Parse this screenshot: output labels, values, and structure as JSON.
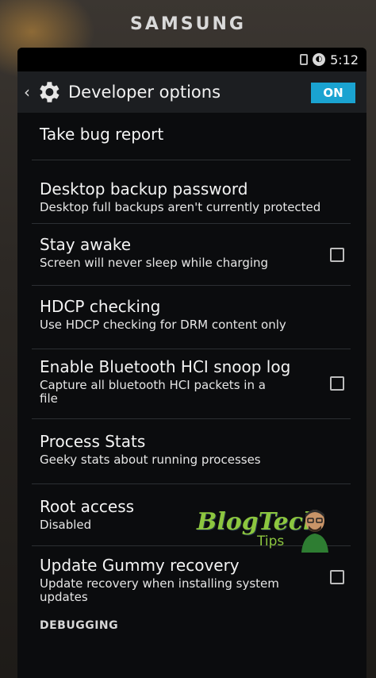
{
  "device": {
    "brand": "SAMSUNG"
  },
  "statusbar": {
    "time": "5:12"
  },
  "actionbar": {
    "title": "Developer options",
    "toggle_label": "ON",
    "accent": "#1aa3d1"
  },
  "items": [
    {
      "title": "Take bug report",
      "summary": ""
    },
    {
      "title": "Desktop backup password",
      "summary": "Desktop full backups aren't currently protected"
    },
    {
      "title": "Stay awake",
      "summary": "Screen will never sleep while charging",
      "checked": false
    },
    {
      "title": "HDCP checking",
      "summary": "Use HDCP checking for DRM content only"
    },
    {
      "title": "Enable Bluetooth HCI snoop log",
      "summary": "Capture all bluetooth HCI packets in a file",
      "checked": false
    },
    {
      "title": "Process Stats",
      "summary": "Geeky stats about running processes"
    },
    {
      "title": "Root access",
      "summary": "Disabled"
    },
    {
      "title": "Update Gummy recovery",
      "summary": "Update recovery when installing system updates",
      "checked": false
    }
  ],
  "section": {
    "debugging": "DEBUGGING"
  },
  "watermark": {
    "main": "BlogTech",
    "sub": "Tips",
    "color": "#8cc63f"
  }
}
